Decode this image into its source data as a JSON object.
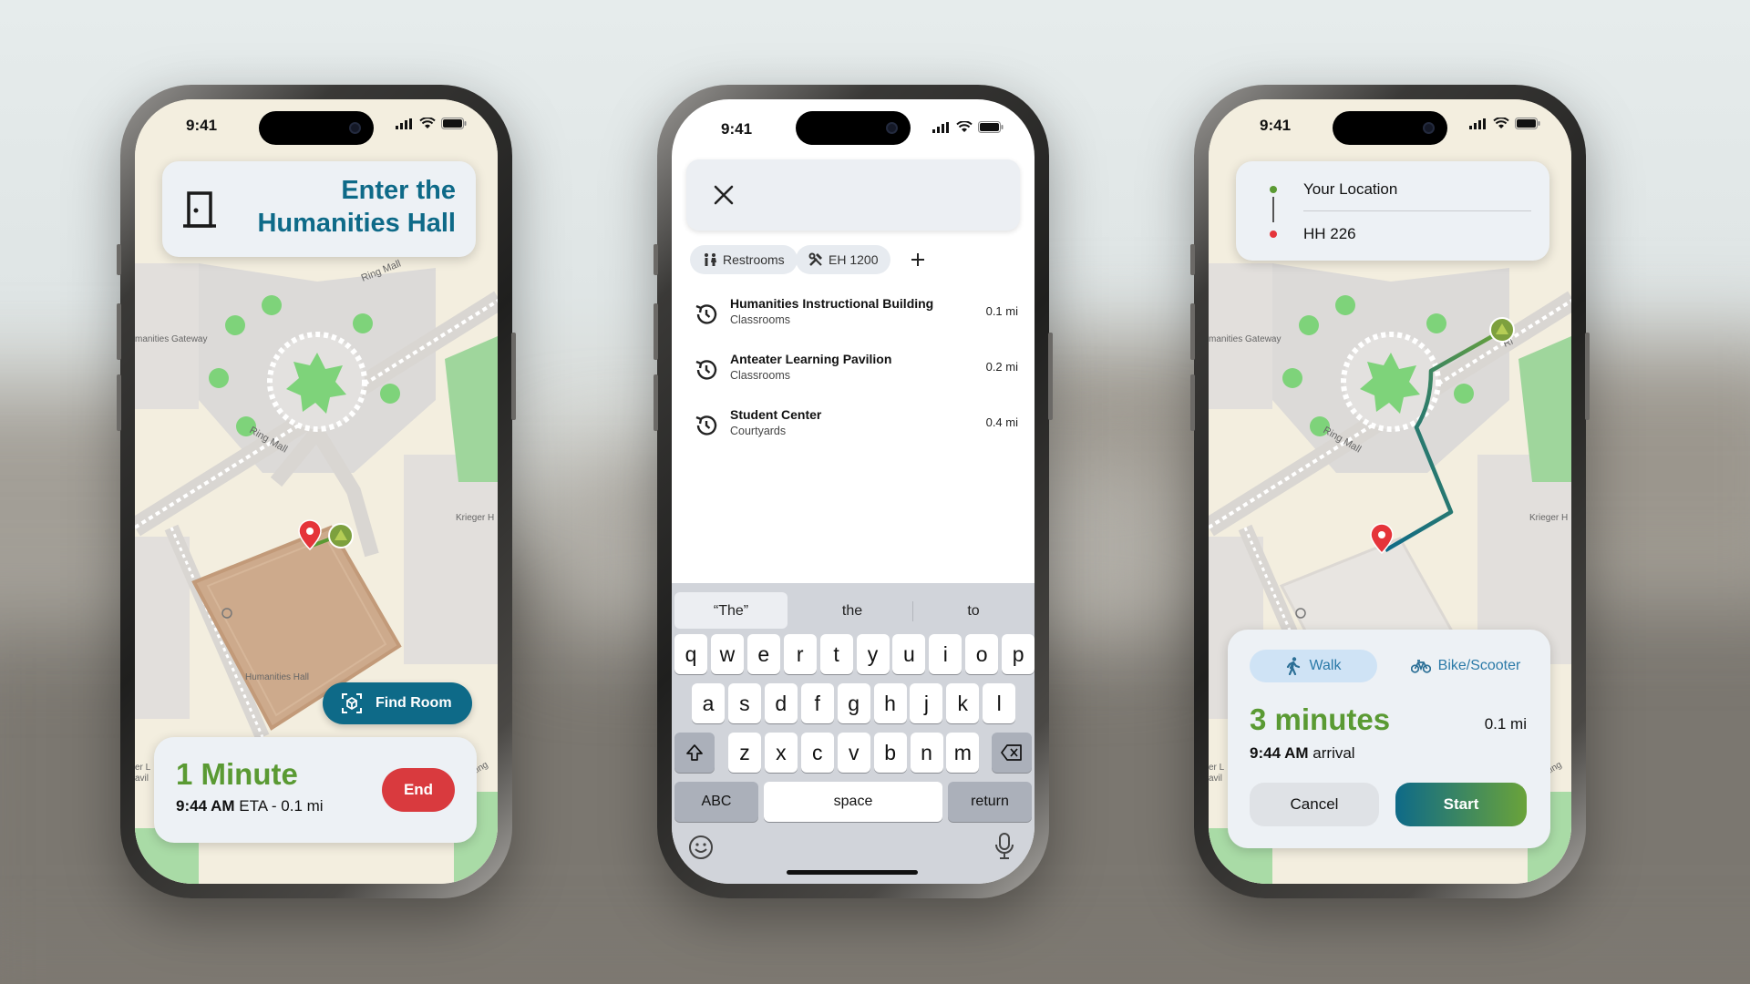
{
  "status": {
    "time": "9:41"
  },
  "screen1": {
    "banner": {
      "line1": "Enter the",
      "line2": "Humanities Hall",
      "icon": "door-icon"
    },
    "map_labels": {
      "gateway": "manities Gateway",
      "ring_mall_1": "Ring Mall",
      "ring_mall_2": "Ring Mall",
      "krieger": "Krieger H",
      "humanities_hall": "Humanities Hall",
      "edge_left": "er L",
      "edge_left2": "avil",
      "edge_right": "ting"
    },
    "find_room": {
      "label": "Find Room",
      "icon": "scan-icon"
    },
    "trip": {
      "duration": "1 Minute",
      "eta_time": "9:44 AM",
      "eta_rest": "ETA - 0.1 mi",
      "end_label": "End"
    }
  },
  "screen2": {
    "chips": [
      {
        "label": "Restrooms",
        "icon": "restroom-icon"
      },
      {
        "label": "EH 1200",
        "icon": "tools-icon"
      }
    ],
    "results": [
      {
        "name": "Humanities Instructional Building",
        "category": "Classrooms",
        "distance": "0.1 mi"
      },
      {
        "name": "Anteater Learning Pavilion",
        "category": "Classrooms",
        "distance": "0.2 mi"
      },
      {
        "name": "Student Center",
        "category": "Courtyards",
        "distance": "0.4 mi"
      }
    ],
    "keyboard": {
      "suggestions": [
        "“The”",
        "the",
        "to"
      ],
      "row1": [
        "q",
        "w",
        "e",
        "r",
        "t",
        "y",
        "u",
        "i",
        "o",
        "p"
      ],
      "row2": [
        "a",
        "s",
        "d",
        "f",
        "g",
        "h",
        "j",
        "k",
        "l"
      ],
      "row3": [
        "z",
        "x",
        "c",
        "v",
        "b",
        "n",
        "m"
      ],
      "abc": "ABC",
      "space": "space",
      "return": "return"
    }
  },
  "screen3": {
    "route": {
      "from": "Your Location",
      "to": "HH 226"
    },
    "map_labels": {
      "gateway": "manities Gateway",
      "ring_mall": "Ring Mall",
      "krieger": "Krieger H",
      "edge_left": "er L",
      "edge_left2": "avil",
      "edge_right": "ting",
      "ring_top": "Ri"
    },
    "modes": [
      {
        "label": "Walk",
        "icon": "walk-icon"
      },
      {
        "label": "Bike/Scooter",
        "icon": "bike-icon"
      }
    ],
    "summary": {
      "duration": "3 minutes",
      "distance": "0.1 mi",
      "arrival_time": "9:44 AM",
      "arrival_rest": "arrival"
    },
    "cancel_label": "Cancel",
    "start_label": "Start"
  },
  "colors": {
    "teal": "#0e6a88",
    "green": "#5a9a33",
    "red": "#d93a3e",
    "map_bg": "#f3eedf"
  }
}
